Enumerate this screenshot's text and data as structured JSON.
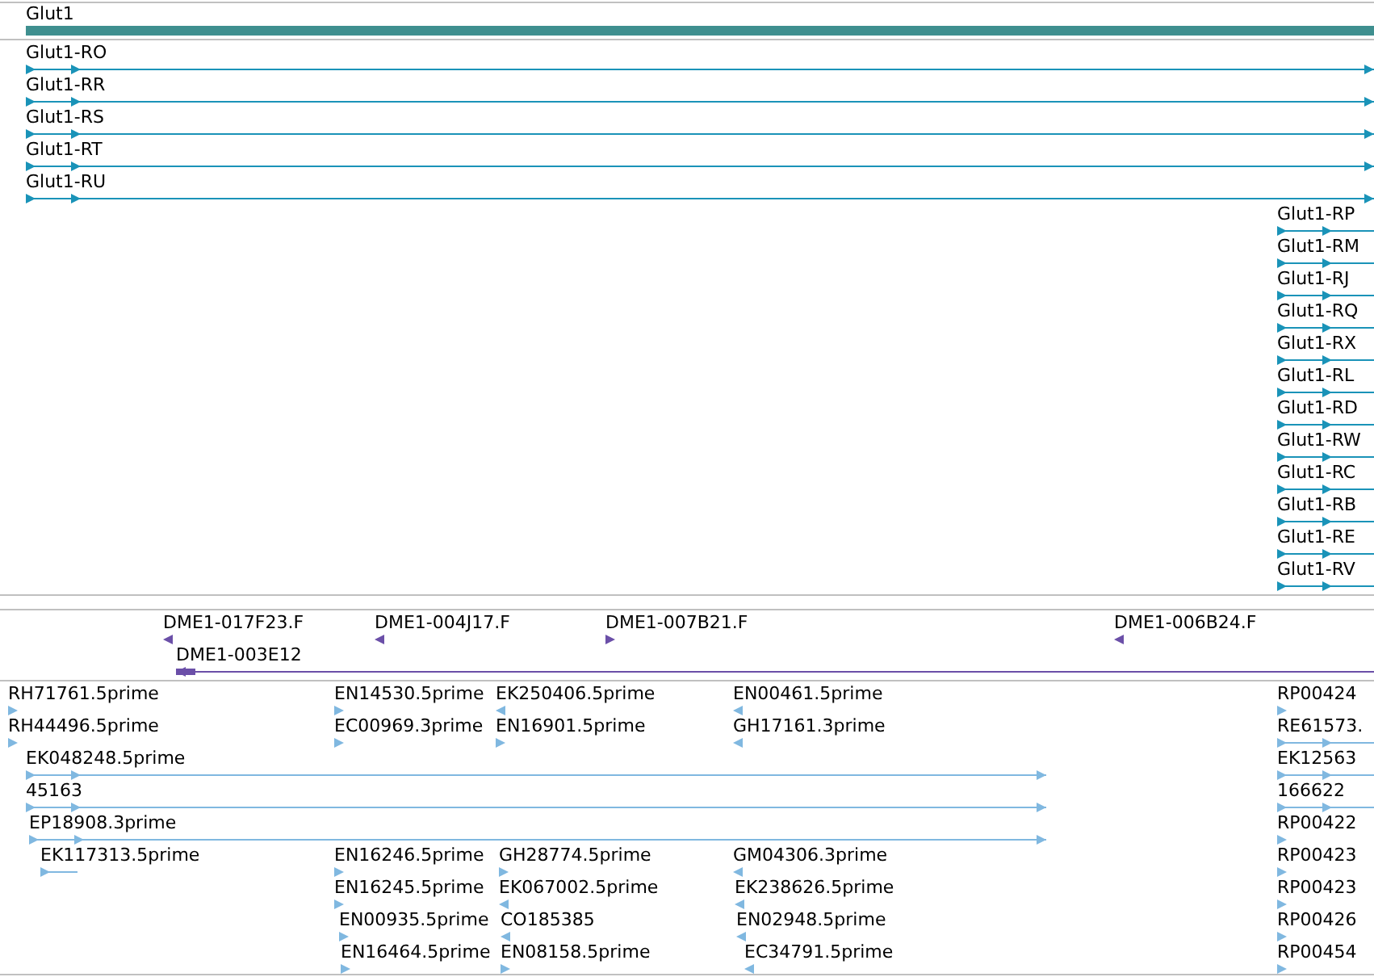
{
  "gene_track": {
    "label": "Glut1"
  },
  "transcripts": [
    {
      "label": "Glut1-RO",
      "reverse": false
    },
    {
      "label": "Glut1-RR",
      "reverse": false
    },
    {
      "label": "Glut1-RS",
      "reverse": false
    },
    {
      "label": "Glut1-RT",
      "reverse": false
    },
    {
      "label": "Glut1-RU",
      "reverse": false
    },
    {
      "label": "Glut1-RP",
      "reverse": false
    },
    {
      "label": "Glut1-RM",
      "reverse": false
    },
    {
      "label": "Glut1-RJ",
      "reverse": false
    },
    {
      "label": "Glut1-RQ",
      "reverse": false
    },
    {
      "label": "Glut1-RX",
      "reverse": false
    },
    {
      "label": "Glut1-RL",
      "reverse": false
    },
    {
      "label": "Glut1-RD",
      "reverse": false
    },
    {
      "label": "Glut1-RW",
      "reverse": false
    },
    {
      "label": "Glut1-RC",
      "reverse": false
    },
    {
      "label": "Glut1-RB",
      "reverse": false
    },
    {
      "label": "Glut1-RE",
      "reverse": false
    },
    {
      "label": "Glut1-RV",
      "reverse": false
    }
  ],
  "clones": [
    {
      "label": "DME1-017F23.F",
      "reverse": true
    },
    {
      "label": "DME1-004J17.F",
      "reverse": true
    },
    {
      "label": "DME1-007B21.F",
      "reverse": false
    },
    {
      "label": "DME1-006B24.F",
      "reverse": true
    },
    {
      "label": "DME1-003E12",
      "reverse": true
    }
  ],
  "ests": [
    {
      "label": "RH71761.5prime",
      "reverse": false
    },
    {
      "label": "EN14530.5prime",
      "reverse": false
    },
    {
      "label": "EK250406.5prime",
      "reverse": true
    },
    {
      "label": "EN00461.5prime",
      "reverse": true
    },
    {
      "label": "RP00424",
      "reverse": false
    },
    {
      "label": "RH44496.5prime",
      "reverse": false
    },
    {
      "label": "EC00969.3prime",
      "reverse": false
    },
    {
      "label": "EN16901.5prime",
      "reverse": false
    },
    {
      "label": "GH17161.3prime",
      "reverse": true
    },
    {
      "label": "RE61573.",
      "reverse": false
    },
    {
      "label": "EK048248.5prime",
      "reverse": false
    },
    {
      "label": "EK12563",
      "reverse": false
    },
    {
      "label": "45163",
      "reverse": false
    },
    {
      "label": "166622",
      "reverse": false
    },
    {
      "label": "EP18908.3prime",
      "reverse": false
    },
    {
      "label": "RP00422",
      "reverse": false
    },
    {
      "label": "EK117313.5prime",
      "reverse": false
    },
    {
      "label": "EN16246.5prime",
      "reverse": false
    },
    {
      "label": "GH28774.5prime",
      "reverse": false
    },
    {
      "label": "GM04306.3prime",
      "reverse": true
    },
    {
      "label": "RP00423",
      "reverse": false
    },
    {
      "label": "EN16245.5prime",
      "reverse": false
    },
    {
      "label": "EK067002.5prime",
      "reverse": true
    },
    {
      "label": "EK238626.5prime",
      "reverse": true
    },
    {
      "label": "RP00423",
      "reverse": false
    },
    {
      "label": "EN00935.5prime",
      "reverse": false
    },
    {
      "label": "CO185385",
      "reverse": true
    },
    {
      "label": "EN02948.5prime",
      "reverse": true
    },
    {
      "label": "RP00426",
      "reverse": false
    },
    {
      "label": "EN16464.5prime",
      "reverse": false
    },
    {
      "label": "EN08158.5prime",
      "reverse": false
    },
    {
      "label": "EC34791.5prime",
      "reverse": true
    },
    {
      "label": "RP00454",
      "reverse": false
    }
  ]
}
